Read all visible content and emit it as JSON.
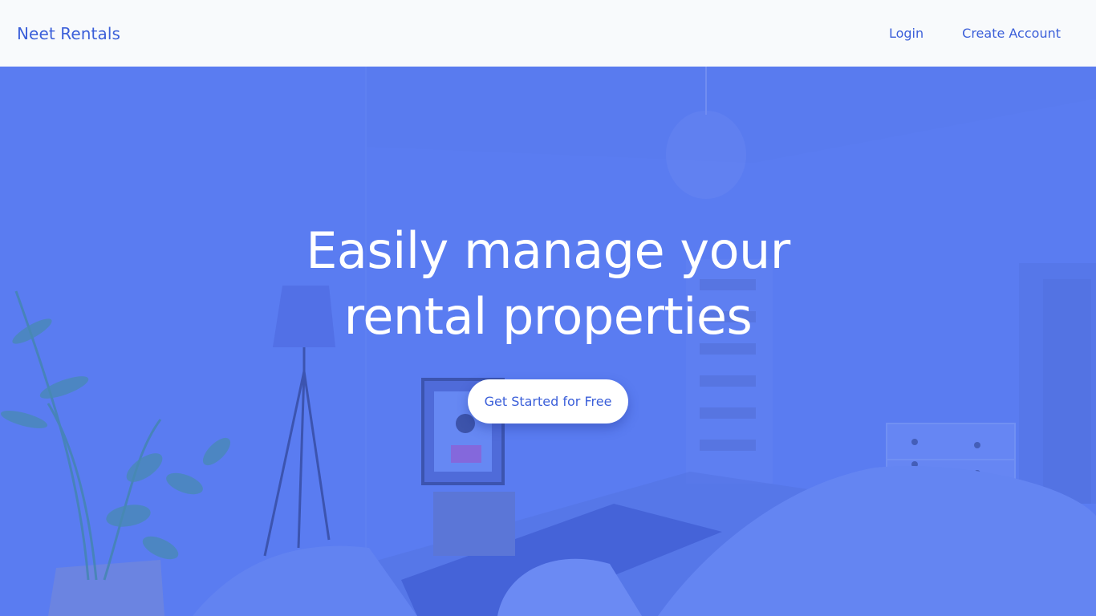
{
  "navbar": {
    "brand": "Neet Rentals",
    "links": [
      {
        "label": "Login"
      },
      {
        "label": "Create Account"
      }
    ]
  },
  "hero": {
    "title": "Easily manage your rental properties",
    "cta_label": "Get Started for Free",
    "background_image": "bedroom-interior-photo"
  },
  "colors": {
    "brand": "#3b5fd9",
    "hero_overlay": "#5a7cf0",
    "navbar_bg": "#f8fafc",
    "button_bg": "#ffffff"
  }
}
